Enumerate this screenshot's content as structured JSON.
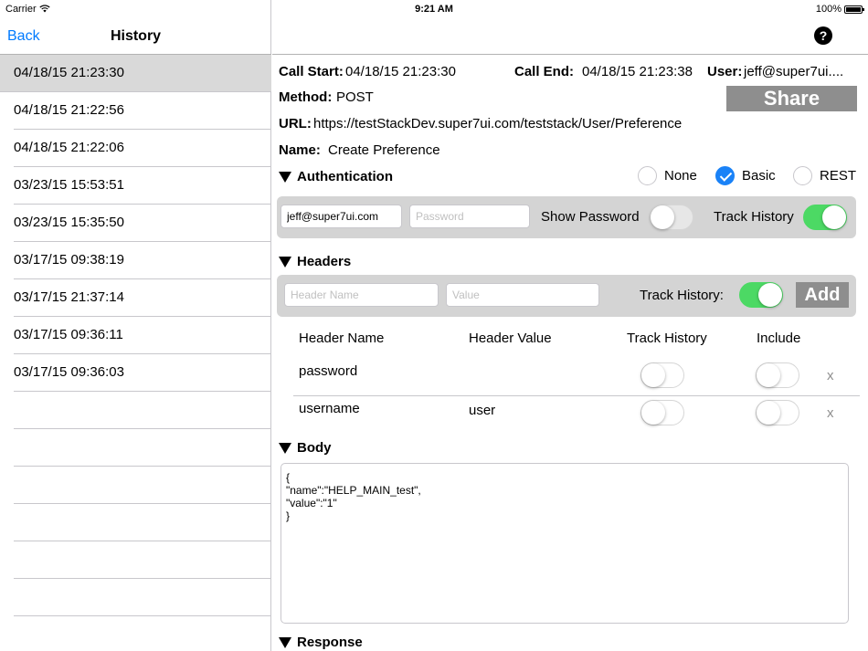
{
  "status": {
    "carrier": "Carrier",
    "time": "9:21 AM",
    "battery": "100%"
  },
  "left": {
    "back": "Back",
    "title": "History",
    "items": [
      "04/18/15 21:23:30",
      "04/18/15 21:22:56",
      "04/18/15 21:22:06",
      "03/23/15 15:53:51",
      "03/23/15 15:35:50",
      "03/17/15 09:38:19",
      "03/17/15 21:37:14",
      "03/17/15 09:36:11",
      "03/17/15 09:36:03"
    ]
  },
  "right": {
    "help_icon": "?",
    "call_start_label": "Call Start:",
    "call_start": "04/18/15 21:23:30",
    "call_end_label": "Call End:",
    "call_end": "04/18/15 21:23:38",
    "user_label": "User:",
    "user": "jeff@super7ui....",
    "method_label": "Method:",
    "method": "POST",
    "share": "Share",
    "url_label": "URL:",
    "url": "https://testStackDev.super7ui.com/teststack/User/Preference",
    "name_label": "Name:",
    "name": "Create Preference"
  },
  "auth": {
    "title": "Authentication",
    "options": [
      "None",
      "Basic",
      "REST"
    ],
    "selected": "Basic",
    "username": "jeff@super7ui.com",
    "password_placeholder": "Password",
    "show_password": "Show Password",
    "show_password_on": false,
    "track_history": "Track History",
    "track_history_on": true
  },
  "headers": {
    "title": "Headers",
    "name_placeholder": "Header Name",
    "value_placeholder": "Value",
    "track_history": "Track History:",
    "track_history_on": true,
    "add": "Add",
    "columns": [
      "Header Name",
      "Header Value",
      "Track History",
      "Include"
    ],
    "rows": [
      {
        "name": "password",
        "value": "",
        "track": false,
        "include": false,
        "delete": "x"
      },
      {
        "name": "username",
        "value": "user",
        "track": false,
        "include": false,
        "delete": "x"
      }
    ]
  },
  "body": {
    "title": "Body",
    "lines": [
      "{",
      "\"name\":\"HELP_MAIN_test\",",
      "\"value\":\"1\"",
      "}"
    ]
  },
  "response": {
    "title": "Response"
  }
}
